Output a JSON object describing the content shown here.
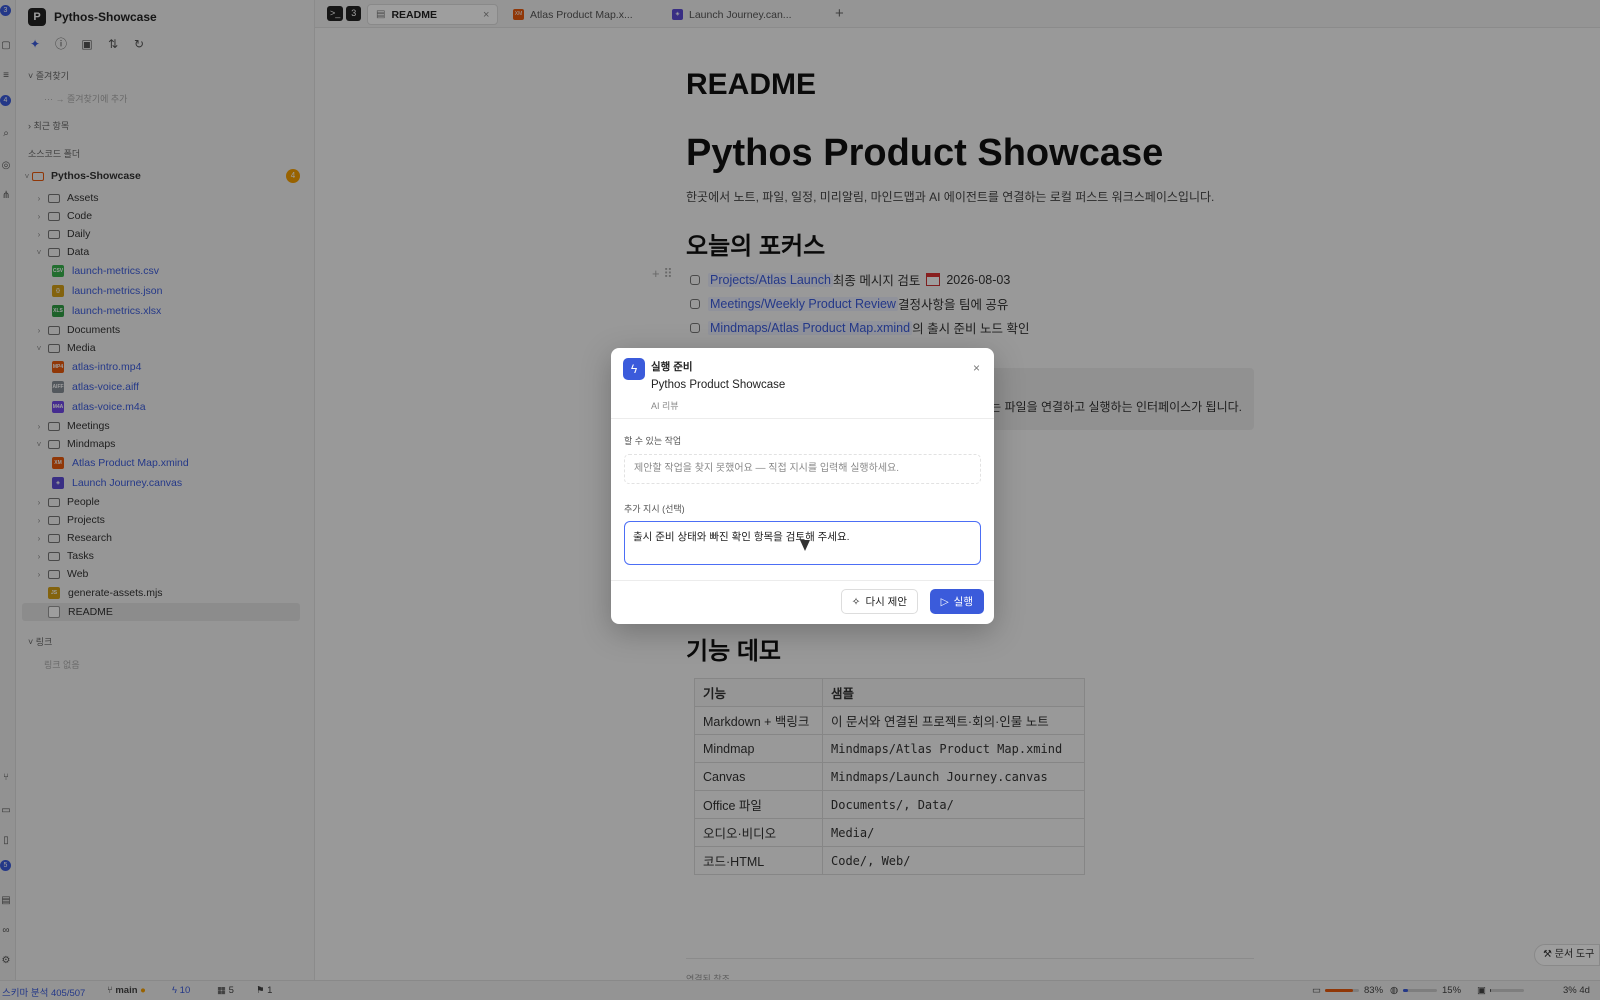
{
  "app": {
    "workspace": "Pythos-Showcase",
    "workspace_logo": "P"
  },
  "activity_badges": [
    "3",
    "4",
    "5"
  ],
  "sidebar": {
    "favorites_label": "즐겨찾기",
    "favorites_add": "··· → 즐겨찾기에 추가",
    "recent_label": "최근 항목",
    "source_label": "소스코드 폴더",
    "root_name": "Pythos-Showcase",
    "root_badge": "4",
    "items": [
      {
        "label": "Assets"
      },
      {
        "label": "Code"
      },
      {
        "label": "Daily"
      },
      {
        "label": "Data"
      },
      {
        "label": "launch-metrics.csv",
        "badge": "CSV"
      },
      {
        "label": "launch-metrics.json",
        "badge": "{}"
      },
      {
        "label": "launch-metrics.xlsx",
        "badge": "XLS"
      },
      {
        "label": "Documents"
      },
      {
        "label": "Media"
      },
      {
        "label": "atlas-intro.mp4",
        "badge": "MP4"
      },
      {
        "label": "atlas-voice.aiff",
        "badge": "AIFF"
      },
      {
        "label": "atlas-voice.m4a",
        "badge": "M4A"
      },
      {
        "label": "Meetings"
      },
      {
        "label": "Mindmaps"
      },
      {
        "label": "Atlas Product Map.xmind",
        "badge": "XM"
      },
      {
        "label": "Launch Journey.canvas",
        "badge": "◈"
      },
      {
        "label": "People"
      },
      {
        "label": "Projects"
      },
      {
        "label": "Research"
      },
      {
        "label": "Tasks"
      },
      {
        "label": "Web"
      },
      {
        "label": "generate-assets.mjs",
        "badge": "JS"
      },
      {
        "label": "README"
      }
    ],
    "links_label": "링크",
    "links_empty": "링크 없음"
  },
  "tabs": {
    "terminal_count": "3",
    "items": [
      {
        "label": "README"
      },
      {
        "label": "Atlas Product Map.x..."
      },
      {
        "label": "Launch Journey.can..."
      }
    ],
    "add": "+"
  },
  "document": {
    "heading": "README",
    "title": "Pythos Product Showcase",
    "lead": "한곳에서 노트, 파일, 일정, 미리알림, 마인드맵과 AI 에이전트를 연결하는 로컬 퍼스트 워크스페이스입니다.",
    "focus_heading": "오늘의 포커스",
    "tasks": [
      {
        "link": "Projects/Atlas Launch",
        "text": " 최종 메시지 검토",
        "date": "2026-08-03"
      },
      {
        "link": "Meetings/Weekly Product Review",
        "text": " 결정사항을 팀에 공유"
      },
      {
        "link": "Mindmaps/Atlas Product Map.xmind",
        "text": "의 출시 준비 노드 확인"
      }
    ],
    "callout_text": "는 파일을 연결하고 실행하는 인터페이스가 됩니다.",
    "demo_heading": "기능 데모",
    "table": {
      "headers": [
        "기능",
        "샘플"
      ],
      "rows": [
        [
          "Markdown + 백링크",
          "이 문서와 연결된 프로젝트·회의·인물 노트"
        ],
        [
          "Mindmap",
          "Mindmaps/Atlas Product Map.xmind"
        ],
        [
          "Canvas",
          "Mindmaps/Launch Journey.canvas"
        ],
        [
          "Office 파일",
          "Documents/, Data/"
        ],
        [
          "오디오·비디오",
          "Media/"
        ],
        [
          "코드·HTML",
          "Code/, Web/"
        ]
      ]
    },
    "footer_note": "연결된 참조",
    "doc_tools": "문서 도구"
  },
  "modal": {
    "kicker": "실행 준비",
    "subject": "Pythos Product Showcase",
    "tag": "AI 리뷰",
    "actions_label": "할 수 있는 작업",
    "actions_empty": "제안할 작업을 찾지 못했어요 — 직접 지시를 입력해 실행하세요.",
    "extra_label": "추가 지시 (선택)",
    "extra_value": "출시 준비 상태와 빠진 확인 항목을 검토해 주세요.",
    "redo_label": "다시 제안",
    "run_label": "실행"
  },
  "status": {
    "schema": "스키마 분석 405/507",
    "branch": "main",
    "agents": "10",
    "docs": "5",
    "pins": "1",
    "meter1_pct": "83%",
    "meter1_fill": 0.83,
    "meter2_pct": "15%",
    "meter2_fill": 0.15,
    "meter3_pct": "3% 4d",
    "meter3_fill": 0.03
  },
  "colors": {
    "accent": "#3b5bdb",
    "badge_orange": "#f59f00",
    "link": "#3b5bdb"
  }
}
